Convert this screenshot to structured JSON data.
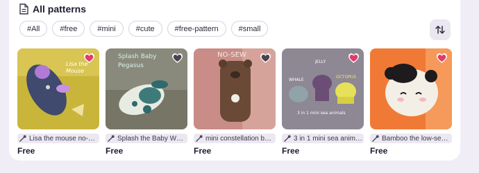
{
  "section": {
    "title": "All patterns"
  },
  "tags": [
    "#All",
    "#free",
    "#mini",
    "#cute",
    "#free-pattern",
    "#small"
  ],
  "cards": [
    {
      "name": "Lisa the mouse no-…",
      "price": "Free",
      "favorited": true,
      "art_text": "Lisa the Mouse"
    },
    {
      "name": "Splash the Baby W…",
      "price": "Free",
      "favorited": false,
      "art_text": "Splash Baby Pegasus"
    },
    {
      "name": "mini constellation b…",
      "price": "Free",
      "favorited": false,
      "art_text": "NO-SEW"
    },
    {
      "name": "3 in 1 mini sea anim…",
      "price": "Free",
      "favorited": true,
      "art_text": "3 in 1 mini sea animals",
      "labels": [
        "WHALE",
        "JELLY",
        "OCTOPUS"
      ]
    },
    {
      "name": "Bamboo the low-se…",
      "price": "Free",
      "favorited": true,
      "art_text": ""
    }
  ],
  "colors": {
    "heart_filled": "#e23a6b",
    "heart_empty": "#4a4350",
    "accent_bg": "#ebe7f1"
  }
}
